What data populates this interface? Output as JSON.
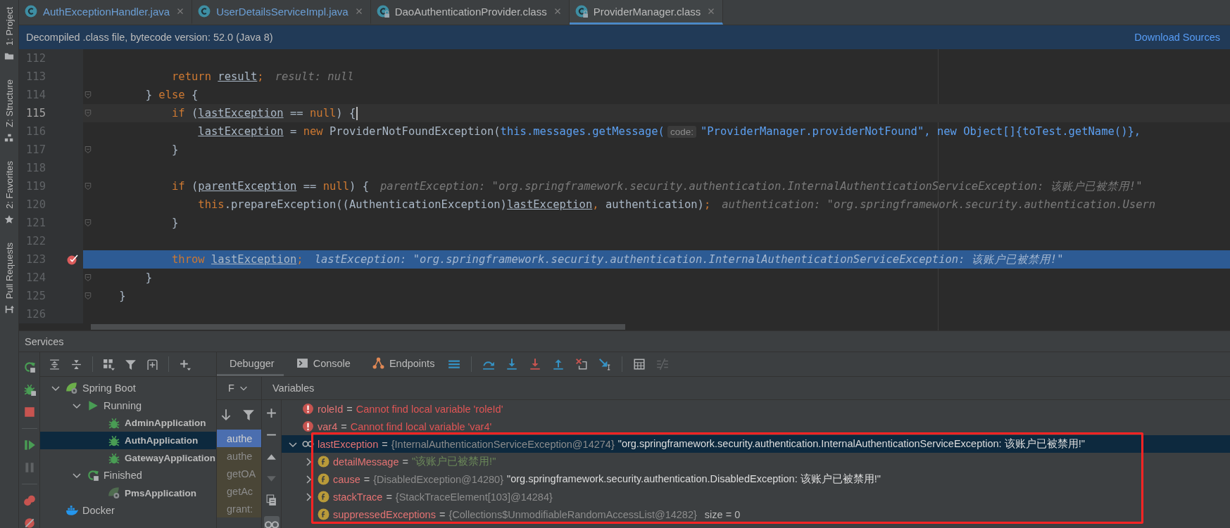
{
  "tool_strip": [
    {
      "label": "1: Project",
      "kind": "project"
    },
    {
      "label": "Z: Structure",
      "kind": "structure"
    },
    {
      "label": "2: Favorites",
      "kind": "favorites"
    },
    {
      "label": "Pull Requests",
      "kind": "pull_requests"
    }
  ],
  "editor_tabs": [
    {
      "label": "AuthExceptionHandler.java",
      "locked": false,
      "changed": true,
      "selected": false
    },
    {
      "label": "UserDetailsServiceImpl.java",
      "locked": false,
      "changed": true,
      "selected": false
    },
    {
      "label": "DaoAuthenticationProvider.class",
      "locked": true,
      "changed": false,
      "selected": false
    },
    {
      "label": "ProviderManager.class",
      "locked": true,
      "changed": false,
      "selected": true
    }
  ],
  "banner": {
    "message": "Decompiled .class file, bytecode version: 52.0 (Java 8)",
    "link": "Download Sources"
  },
  "code_lines": [
    {
      "number": "112",
      "fold": false,
      "current": false,
      "execution_point": false,
      "breakpoint": false
    },
    {
      "number": "113",
      "fold": false,
      "current": false,
      "execution_point": false,
      "breakpoint": false,
      "parts": [
        {
          "kind": "code",
          "tokens": [
            {
              "kind": "keyword",
              "text": "            return "
            },
            {
              "kind": "variable",
              "text": "result"
            },
            {
              "kind": "keyword",
              "text": ";"
            }
          ]
        },
        {
          "kind": "value_hint",
          "text": "result: null"
        }
      ]
    },
    {
      "number": "114",
      "fold": true,
      "current": false,
      "execution_point": false,
      "breakpoint": false,
      "parts": [
        {
          "kind": "code",
          "tokens": [
            {
              "kind": "plain",
              "text": "        } "
            },
            {
              "kind": "keyword",
              "text": "else"
            },
            {
              "kind": "plain",
              "text": " {"
            }
          ]
        }
      ]
    },
    {
      "number": "115",
      "fold": true,
      "current": true,
      "execution_point": false,
      "breakpoint": false,
      "parts": [
        {
          "kind": "code",
          "tokens": [
            {
              "kind": "keyword",
              "text": "            if"
            },
            {
              "kind": "plain",
              "text": " ("
            },
            {
              "kind": "variable",
              "text": "lastException"
            },
            {
              "kind": "plain",
              "text": " == "
            },
            {
              "kind": "keyword",
              "text": "null"
            },
            {
              "kind": "plain",
              "text": ") {"
            }
          ]
        }
      ]
    },
    {
      "number": "116",
      "fold": false,
      "current": false,
      "execution_point": false,
      "breakpoint": false,
      "parts": [
        {
          "kind": "code",
          "tokens": [
            {
              "kind": "variable",
              "text": "                lastException"
            },
            {
              "kind": "plain",
              "text": " = "
            },
            {
              "kind": "keyword",
              "text": "new"
            },
            {
              "kind": "plain",
              "text": " ProviderNotFoundException("
            },
            {
              "kind": "link",
              "text": "this.messages.getMessage("
            }
          ]
        },
        {
          "kind": "param_hint",
          "text": "code:"
        },
        {
          "kind": "code",
          "tokens": [
            {
              "kind": "link",
              "text": "\"ProviderManager.providerNotFound\", new Object[]{toTest.getName()},"
            }
          ]
        }
      ]
    },
    {
      "number": "117",
      "fold": true,
      "current": false,
      "execution_point": false,
      "breakpoint": false,
      "parts": [
        {
          "kind": "code",
          "tokens": [
            {
              "kind": "plain",
              "text": "            }"
            }
          ]
        }
      ]
    },
    {
      "number": "118",
      "fold": false,
      "current": false,
      "execution_point": false,
      "breakpoint": false
    },
    {
      "number": "119",
      "fold": true,
      "current": false,
      "execution_point": false,
      "breakpoint": false,
      "parts": [
        {
          "kind": "code",
          "tokens": [
            {
              "kind": "keyword",
              "text": "            if"
            },
            {
              "kind": "plain",
              "text": " ("
            },
            {
              "kind": "variable",
              "text": "parentException"
            },
            {
              "kind": "plain",
              "text": " == "
            },
            {
              "kind": "keyword",
              "text": "null"
            },
            {
              "kind": "plain",
              "text": ") {"
            }
          ]
        },
        {
          "kind": "value_hint",
          "text": "parentException: \"org.springframework.security.authentication.InternalAuthenticationServiceException: 该账户已被禁用!\""
        }
      ]
    },
    {
      "number": "120",
      "fold": false,
      "current": false,
      "execution_point": false,
      "breakpoint": false,
      "parts": [
        {
          "kind": "code",
          "tokens": [
            {
              "kind": "keyword",
              "text": "                this"
            },
            {
              "kind": "plain",
              "text": ".prepareException((AuthenticationException)"
            },
            {
              "kind": "variable",
              "text": "lastException"
            },
            {
              "kind": "keyword",
              "text": ","
            },
            {
              "kind": "plain",
              "text": " authentication)"
            },
            {
              "kind": "keyword",
              "text": ";"
            }
          ]
        },
        {
          "kind": "value_hint",
          "text": "authentication: \"org.springframework.security.authentication.Usern"
        }
      ]
    },
    {
      "number": "121",
      "fold": true,
      "current": false,
      "execution_point": false,
      "breakpoint": false,
      "parts": [
        {
          "kind": "code",
          "tokens": [
            {
              "kind": "plain",
              "text": "            }"
            }
          ]
        }
      ]
    },
    {
      "number": "122",
      "fold": false,
      "current": false,
      "execution_point": false,
      "breakpoint": false
    },
    {
      "number": "123",
      "fold": false,
      "current": false,
      "execution_point": true,
      "breakpoint": true,
      "parts": [
        {
          "kind": "code",
          "tokens": [
            {
              "kind": "keyword",
              "text": "            throw "
            },
            {
              "kind": "variable",
              "text": "lastException"
            },
            {
              "kind": "keyword",
              "text": ";"
            }
          ]
        },
        {
          "kind": "value_hint",
          "text": "lastException: \"org.springframework.security.authentication.InternalAuthenticationServiceException: 该账户已被禁用!\""
        }
      ]
    },
    {
      "number": "124",
      "fold": true,
      "current": false,
      "execution_point": false,
      "breakpoint": false,
      "parts": [
        {
          "kind": "code",
          "tokens": [
            {
              "kind": "plain",
              "text": "        }"
            }
          ]
        }
      ]
    },
    {
      "number": "125",
      "fold": true,
      "current": false,
      "execution_point": false,
      "breakpoint": false,
      "parts": [
        {
          "kind": "code",
          "tokens": [
            {
              "kind": "plain",
              "text": "    }"
            }
          ]
        }
      ]
    },
    {
      "number": "126",
      "fold": false,
      "current": false,
      "execution_point": false,
      "breakpoint": false
    }
  ],
  "services": {
    "title": "Services",
    "actions": [
      {
        "kind": "rerun",
        "disabled": false
      },
      {
        "kind": "debug",
        "disabled": false
      },
      {
        "kind": "stop",
        "disabled": false
      },
      {
        "kind": "separator"
      },
      {
        "kind": "resume",
        "disabled": false
      },
      {
        "kind": "pause",
        "disabled": true
      },
      {
        "kind": "separator"
      },
      {
        "kind": "view_breakpoints",
        "disabled": false
      },
      {
        "kind": "mute_breakpoints",
        "disabled": false
      }
    ],
    "toolbar": [
      {
        "kind": "expand_all"
      },
      {
        "kind": "collapse_all"
      },
      {
        "kind": "separator"
      },
      {
        "kind": "group_by"
      },
      {
        "kind": "filter"
      },
      {
        "kind": "new_tab"
      },
      {
        "kind": "separator"
      },
      {
        "kind": "add"
      }
    ],
    "tree": [
      {
        "label": "Spring Boot",
        "kind": "spring_boot",
        "expanded": true,
        "selected": false,
        "children": [
          {
            "label": "Running",
            "kind": "running",
            "expanded": true,
            "selected": false,
            "children": [
              {
                "label": "AdminApplication",
                "kind": "debug_app",
                "selected": false
              },
              {
                "label": "AuthApplication",
                "kind": "debug_app",
                "selected": true
              },
              {
                "label": "GatewayApplication",
                "kind": "debug_app",
                "selected": false
              }
            ]
          },
          {
            "label": "Finished",
            "kind": "finished",
            "expanded": true,
            "selected": false,
            "children": [
              {
                "label": "PmsApplication",
                "kind": "stopped_app",
                "selected": false
              }
            ]
          }
        ]
      },
      {
        "label": "Docker",
        "kind": "docker",
        "selected": false
      }
    ]
  },
  "debugger": {
    "tabs": [
      {
        "label": "Debugger",
        "kind": "debugger",
        "selected": true
      },
      {
        "label": "Console",
        "kind": "console",
        "selected": false
      },
      {
        "label": "Endpoints",
        "kind": "endpoints",
        "selected": false
      }
    ],
    "toolbar": [
      {
        "kind": "threads",
        "disabled": false
      },
      {
        "kind": "separator"
      },
      {
        "kind": "step_over",
        "disabled": false
      },
      {
        "kind": "step_into",
        "disabled": false
      },
      {
        "kind": "force_step_into",
        "disabled": false
      },
      {
        "kind": "step_out",
        "disabled": false
      },
      {
        "kind": "drop_frame",
        "disabled": false
      },
      {
        "kind": "run_to_cursor",
        "disabled": false
      },
      {
        "kind": "separator"
      },
      {
        "kind": "evaluate",
        "disabled": false
      },
      {
        "kind": "trace",
        "disabled": true
      }
    ],
    "frames": {
      "title": "F",
      "toolbar": [
        {
          "kind": "sort_down"
        },
        {
          "kind": "filter"
        }
      ],
      "items": [
        {
          "label": "authe",
          "selected": true
        },
        {
          "label": "authe",
          "selected": false
        },
        {
          "label": "getOA",
          "selected": false
        },
        {
          "label": "getAc",
          "selected": false
        },
        {
          "label": "grant:",
          "selected": false
        }
      ]
    },
    "variables": {
      "title": "Variables",
      "toolbar": [
        {
          "kind": "plus",
          "disabled": false,
          "toggled": false
        },
        {
          "kind": "minus",
          "disabled": false,
          "toggled": false
        },
        {
          "kind": "up",
          "disabled": false,
          "toggled": false
        },
        {
          "kind": "down",
          "disabled": true,
          "toggled": false
        },
        {
          "kind": "copy",
          "disabled": false,
          "toggled": false
        },
        {
          "kind": "watches",
          "disabled": false,
          "toggled": true
        }
      ],
      "rows": [
        {
          "kind": "error",
          "name": "roleId",
          "operator": "=",
          "value": "Cannot find local variable 'roleId'",
          "selected": false
        },
        {
          "kind": "error",
          "name": "var4",
          "operator": "=",
          "value": "Cannot find local variable 'var4'",
          "selected": false
        },
        {
          "kind": "local",
          "name": "lastException",
          "operator": "=",
          "type": "{InternalAuthenticationServiceException@14274}",
          "value": "\"org.springframework.security.authentication.InternalAuthenticationServiceException: 该账户已被禁用!\"",
          "selected": true,
          "expanded": true,
          "children": [
            {
              "kind": "field",
              "name": "detailMessage",
              "operator": "=",
              "value": "\"该账户已被禁用!\"",
              "selected": false,
              "expanded": false
            },
            {
              "kind": "field",
              "name": "cause",
              "operator": "=",
              "type": "{DisabledException@14280}",
              "value": "\"org.springframework.security.authentication.DisabledException: 该账户已被禁用!\"",
              "selected": false,
              "expanded": false
            },
            {
              "kind": "field",
              "name": "stackTrace",
              "operator": "=",
              "type": "{StackTraceElement[103]@14284}",
              "selected": false,
              "expanded": false
            },
            {
              "kind": "field",
              "name": "suppressedExceptions",
              "operator": "=",
              "type": "{Collections$UnmodifiableRandomAccessList@14282}",
              "extra": "size = 0",
              "selected": false
            }
          ]
        }
      ]
    }
  },
  "annotations": [
    {
      "kind": "rectangle"
    }
  ]
}
